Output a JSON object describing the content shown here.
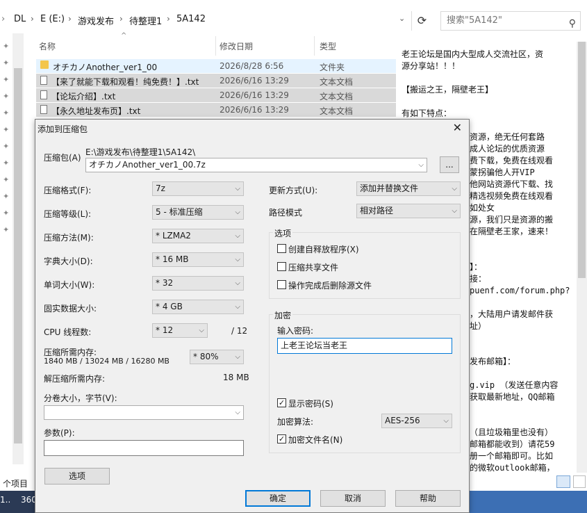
{
  "explorer": {
    "breadcrumbs": [
      "DL",
      "E (E:)",
      "游戏发布",
      "待整理1",
      "5A142"
    ],
    "search_placeholder": "搜索\"5A142\"",
    "columns": {
      "name": "名称",
      "date": "修改日期",
      "type": "类型"
    },
    "files": [
      {
        "name": "オチカノAnother_ver1_00",
        "date": "2026/8/28 6:56",
        "type": "文件夹"
      },
      {
        "name": "【来了就能下载和观看！纯免费！】.txt",
        "date": "2026/6/16 13:29",
        "type": "文本文档"
      },
      {
        "name": "【论坛介绍】.txt",
        "date": "2026/6/16 13:29",
        "type": "文本文档"
      },
      {
        "name": "【永久地址发布页】.txt",
        "date": "2026/6/16 13:29",
        "type": "文本文档"
      }
    ],
    "status_left": "个项目",
    "taskbar_text": "360",
    "preview_lines": [
      "老王论坛是国内大型成人交流社区，资",
      "源分享站！！！",
      "",
      "【搬运之王，隔壁老王】",
      "",
      "有如下特点：",
      "",
      "资源，绝无任何套路",
      "成人论坛的优质资源",
      "费下载，免费在线观看",
      "蒙拐骗他人开VIP",
      "他网站资源代下载、找",
      "精选视频免费在线观看",
      "如处女",
      "源，我们只是资源的搬",
      "在隔壁老王家，速来！",
      "",
      "",
      "】：",
      "接：",
      "puenf.com/forum.php?",
      "",
      "，大陆用户请发邮件获",
      "址）",
      "",
      "",
      "发布邮箱】：",
      "",
      "g.vip  （发送任意内容",
      "获取最新地址，QQ邮箱",
      "",
      "",
      "（且垃圾箱里也没有）",
      "邮箱都能收到）请花59",
      "册一个邮箱即可。比如",
      "的微软outlook邮箱，"
    ]
  },
  "dialog": {
    "title": "添加到压缩包",
    "archive_label": "压缩包(A)",
    "archive_path": "E:\\游戏发布\\待整理1\\5A142\\",
    "archive_name": "オチカノAnother_ver1_00.7z",
    "browse_label": "...",
    "format_label": "压缩格式(F):",
    "format_value": "7z",
    "level_label": "压缩等级(L):",
    "level_value": "5 - 标准压缩",
    "method_label": "压缩方法(M):",
    "method_value": "* LZMA2",
    "dict_label": "字典大小(D):",
    "dict_value": "* 16 MB",
    "word_label": "单词大小(W):",
    "word_value": "* 32",
    "solid_label": "固实数据大小:",
    "solid_value": "* 4 GB",
    "cpu_label": "CPU 线程数:",
    "cpu_value": "* 12",
    "cpu_total": "/ 12",
    "mem_label": "压缩所需内存:",
    "mem_value": "1840 MB / 13024 MB / 16280 MB",
    "mem_percent": "* 80%",
    "decomp_label": "解压缩所需内存:",
    "decomp_value": "18 MB",
    "volume_label": "分卷大小，字节(V):",
    "params_label": "参数(P):",
    "options_button": "选项",
    "update_label": "更新方式(U):",
    "update_value": "添加并替换文件",
    "path_label": "路径模式",
    "path_value": "相对路径",
    "options_group": "选项",
    "opt_sfx": "创建自释放程序(X)",
    "opt_shared": "压缩共享文件",
    "opt_delete": "操作完成后删除源文件",
    "enc_group": "加密",
    "password_label": "输入密码:",
    "password_value": "上老王论坛当老王",
    "show_password": "显示密码(S)",
    "enc_method_label": "加密算法:",
    "enc_method_value": "AES-256",
    "enc_names": "加密文件名(N)",
    "ok": "确定",
    "cancel": "取消",
    "help": "帮助"
  }
}
